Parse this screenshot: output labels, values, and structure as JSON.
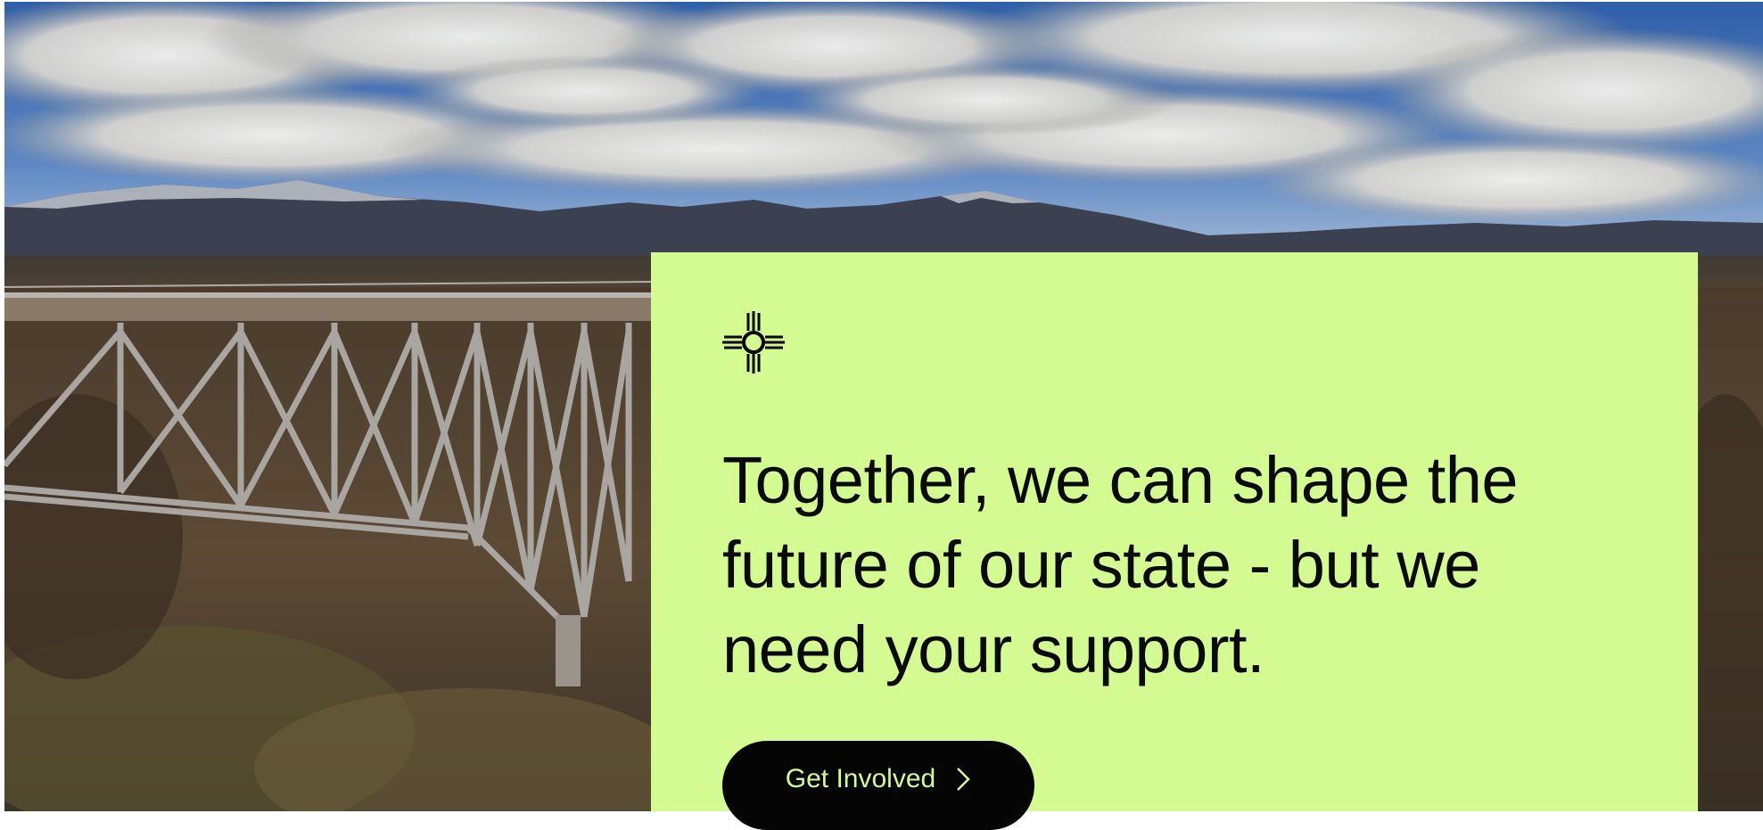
{
  "hero": {
    "image_icon": "landscape-photo-bridge-mountains"
  },
  "cta": {
    "icon": "zia-sun-symbol-icon",
    "headline": "Together, we can shape the future of our state - but we need your support.",
    "button_label": "Get Involved",
    "button_icon": "chevron-right-icon"
  },
  "colors": {
    "panel_bg": "#d4fa92",
    "button_bg": "#050505",
    "button_text": "#d4fa92",
    "headline_text": "#0a0a0a"
  }
}
